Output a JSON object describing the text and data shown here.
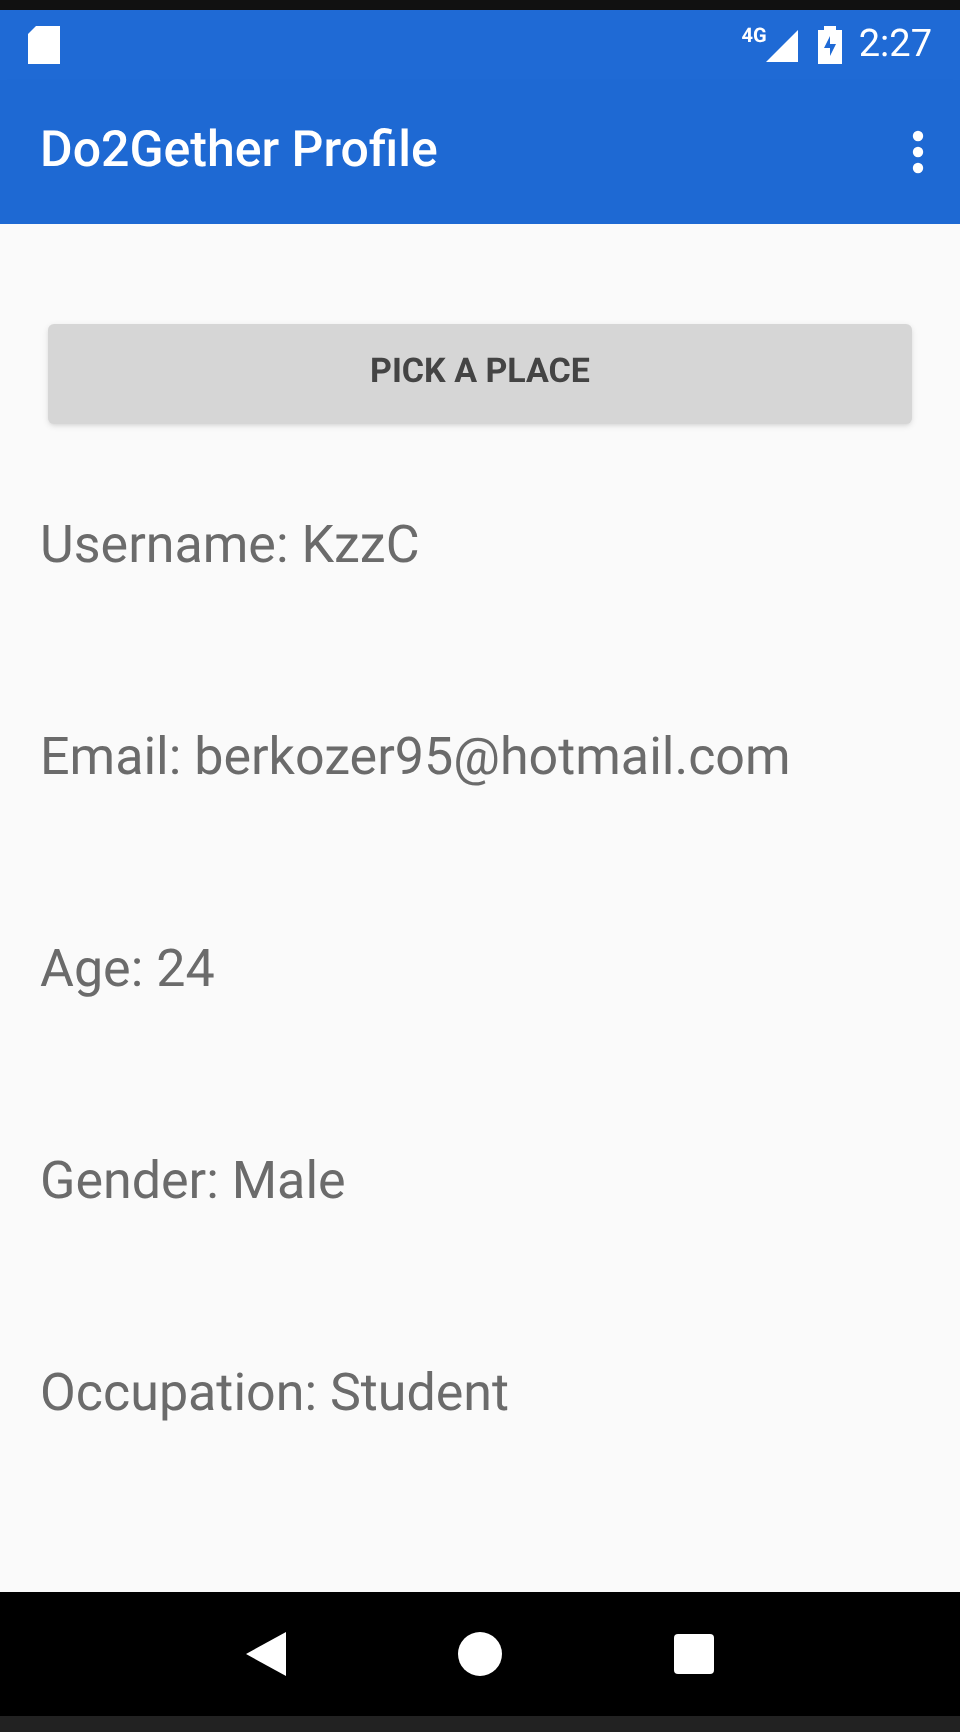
{
  "status_bar": {
    "network": "4G",
    "time": "2:27"
  },
  "app_bar": {
    "title": "Do2Gether Profile"
  },
  "pick_button": {
    "label": "PICK A PLACE"
  },
  "fields": [
    "Username: KzzC",
    "Email: berkozer95@hotmail.com",
    "Age: 24",
    "Gender: Male",
    "Occupation: Student"
  ]
}
